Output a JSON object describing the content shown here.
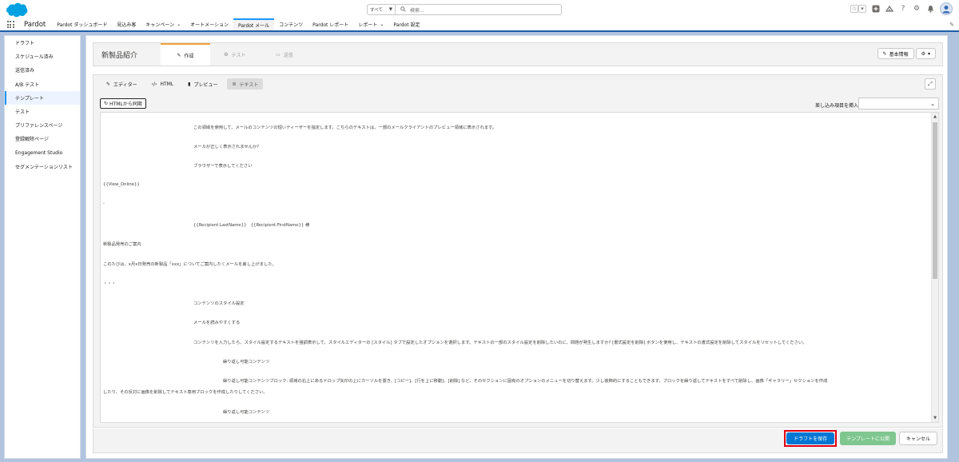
{
  "header": {
    "logo_name": "salesforce-cloud",
    "search_scope": "すべて",
    "search_placeholder": "検索..."
  },
  "app_nav": {
    "app_name": "Pardot",
    "items": [
      {
        "label": "Pardot ダッシュボード"
      },
      {
        "label": "見込み客"
      },
      {
        "label": "キャンペーン"
      },
      {
        "label": "オートメーション"
      },
      {
        "label": "Pardot メール"
      },
      {
        "label": "コンテンツ"
      },
      {
        "label": "Pardot レポート"
      },
      {
        "label": "レポート"
      },
      {
        "label": "Pardot 設定"
      }
    ]
  },
  "sidebar": {
    "items": [
      {
        "label": "ドラフト"
      },
      {
        "label": "スケジュール済み"
      },
      {
        "label": "送信済み"
      },
      {
        "label": "A/B テスト"
      },
      {
        "label": "テンプレート"
      },
      {
        "label": "テスト"
      },
      {
        "label": "プリファレンスページ"
      },
      {
        "label": "登録解除ページ"
      },
      {
        "label": "Engagement Studio"
      },
      {
        "label": "セグメンテーションリスト"
      }
    ]
  },
  "main": {
    "title": "新製品紹介",
    "steps": [
      {
        "label": "作成"
      },
      {
        "label": "テスト"
      },
      {
        "label": "送信"
      }
    ],
    "basic_info_label": "基本情報",
    "editor_tabs": [
      {
        "label": "エディター"
      },
      {
        "label": "HTML"
      },
      {
        "label": "プレビュー"
      },
      {
        "label": "テキスト"
      }
    ],
    "sync_label": "HTMLから同期",
    "merge_label": "差し込み項目を挿入",
    "content_lines": [
      "この領域を使用して、メールのコンテンツの短いティーザーを指定します。こちらのテキストは、一部のメールクライアントのプレビュー領域に表示されます。",
      "メールが正しく表示されませんか?",
      "ブラウザーで表示してください",
      "{{View_Online}}",
      "-",
      "{{Recipient.LastName}}　{{Recipient.FirstName}} 様",
      "新製品発売のご案内",
      "このたびは、x月x日発売の新製品「xxx」についてご案内したくメールを差し上げました。",
      "・・・",
      "コンテンツのスタイル設定",
      "メールを読みやすくする",
      "コンテンツを入力したら、スタイル設定するテキストを強調表示して、スタイルエディターの [スタイル] タブで設定したオプションを選択します。テキストの一部のスタイル設定を削除したいのに、問題が発生しますか? [書式設定を削除] ボタンを使用し、テキストの書式設定を削除してスタイルをリセットしてください。",
      "繰り返し可能コンテンツ",
      "繰り返し可能コンテンツブロック: 領域の右上にあるドロップ矢印の上にカーソルを置き、[コピー]、[行を上に移動]、[削除] など、そのセクションに固有のオプションのメニューを切り替えます。少し装飾的にすることもできます。ブロックを繰り返してテキストをすべて削除し、画像「ギャラリー」セクションを作成",
      "したり、その反対に画像を削除してテキスト専用ブロックを作成したりしてください。",
      "繰り返し可能コンテンツ"
    ]
  },
  "footer": {
    "save_draft": "ドラフトを保存",
    "publish_template": "テンプレートに公開",
    "cancel": "キャンセル"
  },
  "colors": {
    "brand_blue": "#0176d3",
    "publish_green": "#7fc68f",
    "highlight_red": "#e3000f",
    "active_step": "#f0a23a"
  }
}
